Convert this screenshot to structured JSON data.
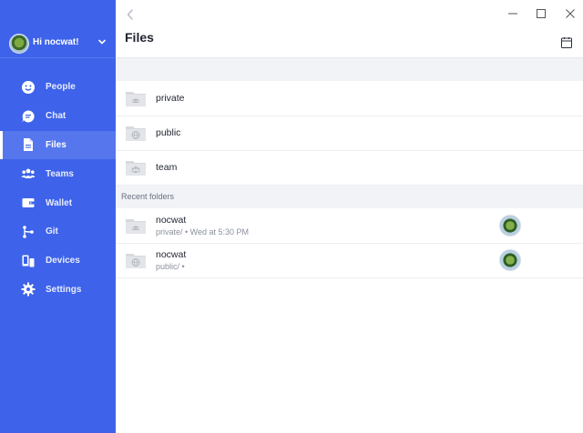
{
  "sidebar": {
    "greeting": "Hi nocwat!",
    "items": [
      {
        "label": "People",
        "icon": "people-icon"
      },
      {
        "label": "Chat",
        "icon": "chat-icon"
      },
      {
        "label": "Files",
        "icon": "file-icon",
        "active": true
      },
      {
        "label": "Teams",
        "icon": "teams-icon"
      },
      {
        "label": "Wallet",
        "icon": "wallet-icon"
      },
      {
        "label": "Git",
        "icon": "git-icon"
      },
      {
        "label": "Devices",
        "icon": "devices-icon"
      },
      {
        "label": "Settings",
        "icon": "gear-icon"
      }
    ],
    "color": "#3e63ea"
  },
  "main": {
    "title": "Files",
    "folders": [
      {
        "name": "private",
        "icon": "private-folder-icon"
      },
      {
        "name": "public",
        "icon": "public-folder-icon"
      },
      {
        "name": "team",
        "icon": "team-folder-icon"
      }
    ],
    "recent_section_label": "Recent folders",
    "recent": [
      {
        "name": "nocwat",
        "meta": "private/ • Wed at 5:30 PM",
        "icon": "private-folder-icon"
      },
      {
        "name": "nocwat",
        "meta": "public/ •",
        "icon": "public-folder-icon"
      }
    ]
  }
}
